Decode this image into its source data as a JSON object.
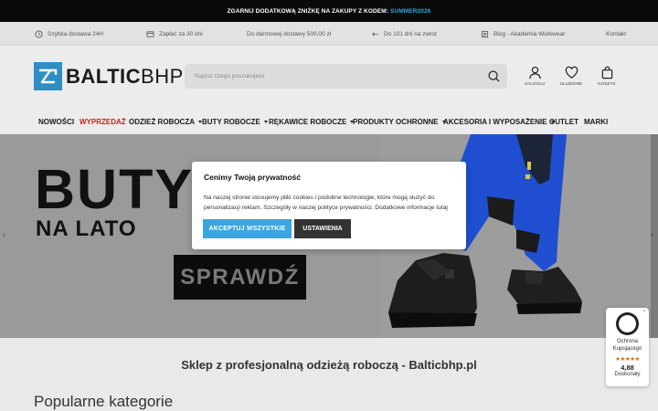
{
  "promo": {
    "text": "ZGARNIJ DODATKOWĄ ZNIŻKĘ NA ZAKUPY Z KODEM:",
    "code": "SUMMER2026"
  },
  "info_bar": {
    "items": [
      {
        "icon": "clock-icon",
        "label": "Szybka dostawa 24H"
      },
      {
        "icon": "credit-card-icon",
        "label": "Zapłać za 30 dni"
      },
      {
        "icon": "",
        "label": "Do darmowej dostawy 500,00 zł"
      },
      {
        "icon": "return-arrow-icon",
        "label": "Do 101 dni na zwrot"
      },
      {
        "icon": "blog-icon",
        "label": "Blog - Akademia Workwear"
      },
      {
        "icon": "",
        "label": "Kontakt"
      }
    ]
  },
  "header": {
    "logo_bold": "BALTIC",
    "logo_light": "BHP",
    "search_placeholder": "Napisz czego poszukujesz",
    "actions": {
      "login": "ZALOGUJ",
      "favorites": "ULUBIONE",
      "cart": "KOSZYK"
    }
  },
  "nav": {
    "items": [
      {
        "label": "NOWOŚCI"
      },
      {
        "label": "WYPRZEDAŻ"
      },
      {
        "label": "ODZIEŻ ROBOCZA"
      },
      {
        "label": "BUTY ROBOCZE"
      },
      {
        "label": "RĘKAWICE ROBOCZE"
      },
      {
        "label": "PRODUKTY OCHRONNE"
      },
      {
        "label": "AKCESORIA I WYPOSAŻENIE"
      },
      {
        "label": "OUTLET"
      },
      {
        "label": "MARKI"
      }
    ]
  },
  "hero": {
    "title_line1": "BUTY",
    "title_line2": "NA LATO",
    "cta": "SPRAWDŹ",
    "prev": "‹",
    "next": "›"
  },
  "main": {
    "tagline": "Sklep z profesjonalną odzieżą roboczą - Balticbhp.pl",
    "section_title": "Popularne kategorie"
  },
  "cookie_modal": {
    "title": "Cenimy Twoją prywatność",
    "body_before": "Na naszej stronie stosujemy pliki cookies i podobne technologie, które mogą służyć do personalizacji reklam. Szczegóły w naszej ",
    "policy_link": "polityce prywatności",
    "body_after": ". Dodatkowe informacje ",
    "more_link": "tutaj",
    "accept": "AKCEPTUJ WSZYSTKIE",
    "settings": "USTAWIENIA"
  },
  "trust_badge": {
    "label": "Ochrona Kupującego",
    "stars": "★★★★★",
    "score": "4,88",
    "rating": "Doskonały"
  },
  "colors": {
    "accent": "#3aa6e0",
    "sale": "#d21c1c",
    "pants_blue": "#1f4fd0",
    "logo_blue": "#2f8fc4"
  }
}
